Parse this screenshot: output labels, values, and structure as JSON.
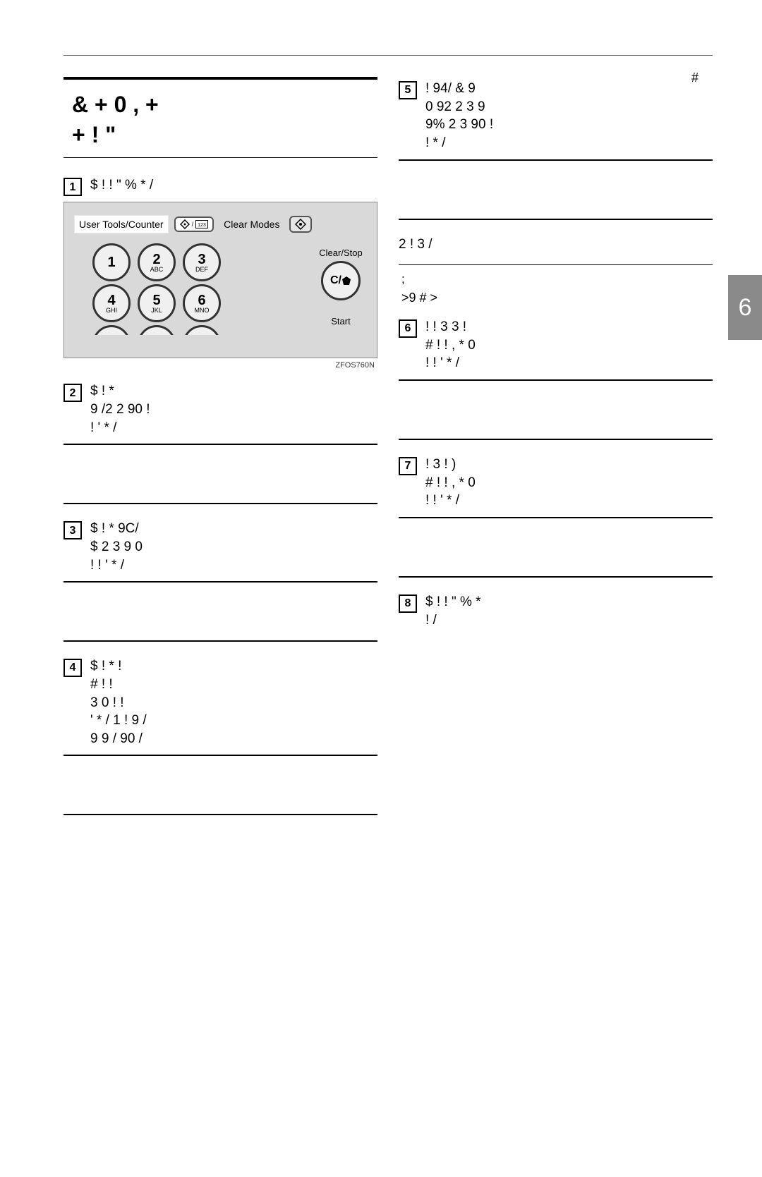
{
  "header": {
    "topic": "#",
    "page_number": "6"
  },
  "section_title_line1": "&   +       0 , +",
  "section_title_line2": "+ !   \"",
  "left_col": {
    "step1_label": "1",
    "step1_text": "$   !   !  \"   %     * /",
    "keypad": {
      "user_tools_label": "User Tools/Counter",
      "clear_modes_label": "Clear Modes",
      "clear_stop_label": "Clear/Stop",
      "start_label": "Start",
      "keys": [
        {
          "d": "1",
          "s": ""
        },
        {
          "d": "2",
          "s": "ABC"
        },
        {
          "d": "3",
          "s": "DEF"
        },
        {
          "d": "4",
          "s": "GHI"
        },
        {
          "d": "5",
          "s": "JKL"
        },
        {
          "d": "6",
          "s": "MNO"
        }
      ],
      "cstop_btn": "C/",
      "caption": "ZFOS760N"
    },
    "step2_label": "2",
    "step2_text": "$   !         *\n9 /2    2    90   !\n      !     ' * /",
    "step3_label": "3",
    "step3_text": "$   !          *    9C/\n   $  2 3 9     0\n!    !      ' * /",
    "step4_label": "4",
    "step4_text": "$   !        *    !\n        #   !  !\n   3  0  !    !\n ' * / 1 !       9 /\n  9  9 /   90           /"
  },
  "right_col": {
    "step5_label": "5",
    "step5_text": "!       94/ &   9\n    0    92    2 3 9\n 9%   2 3 90   !\n!    * /",
    "para1": "2   !         3 /",
    "note_label": "     ;",
    "note_item": ">9  #   >",
    "step6_label": "6",
    "step6_text": "! !  3     3   !\n #  ! !   ,  *  0\n!    !      ' * /",
    "step7_label": "7",
    "step7_text": "!       3   !  )\n #  ! !  ,  *  0\n!    !      ' * /",
    "step8_label": "8",
    "step8_text": "$   !   !  \"   %      *\n       !     /"
  }
}
